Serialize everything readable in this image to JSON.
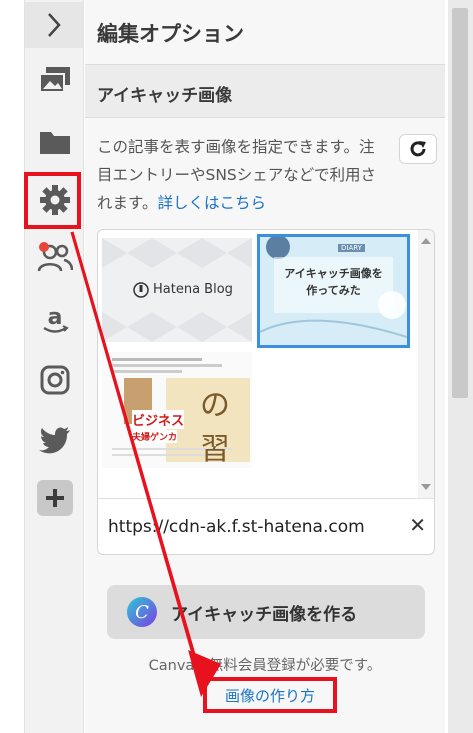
{
  "panel": {
    "title": "編集オプション",
    "section_title": "アイキャッチ画像",
    "description": "この記事を表す画像を指定できます。注目エントリーやSNSシェアなどで利用されます。",
    "details_link": "詳しくはこちら"
  },
  "thumbnails": {
    "hatena_blog_label": "Hatena Blog",
    "eyecatch_title_line1": "アイキャッチ画像を",
    "eyecatch_title_line2": "作ってみた",
    "eyecatch_tag": "DIARY",
    "book_big_chars": "の習",
    "book_red_text": "ビジネス",
    "book_sub_text": "夫婦ゲンカ"
  },
  "url_field": {
    "value": "https://cdn-ak.f.st-hatena.com"
  },
  "canva": {
    "button_label": "アイキャッチ画像を作る",
    "logo_letter": "C",
    "note": "Canvaの無料会員登録が必要です。",
    "howto_link": "画像の作り方"
  },
  "rail": {
    "items": [
      "collapse",
      "images",
      "folder",
      "settings",
      "users",
      "amazon",
      "instagram",
      "twitter",
      "add"
    ]
  },
  "colors": {
    "annotation_red": "#e8121f",
    "link_blue": "#1a73c8",
    "selection_blue": "#3a8fe0"
  }
}
